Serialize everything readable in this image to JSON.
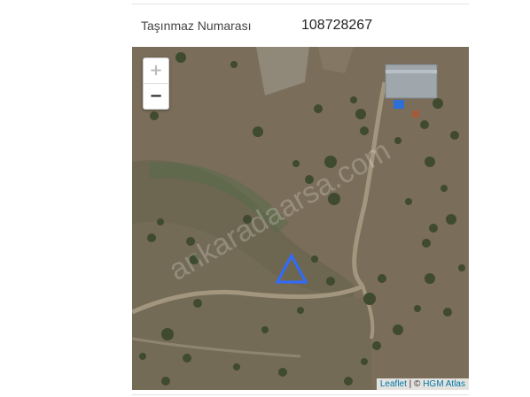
{
  "parcel": {
    "label": "Taşınmaz Numarası",
    "value": "108728267"
  },
  "map": {
    "zoom_in_label": "+",
    "zoom_out_label": "−",
    "watermark": "ankaradaarsa.com",
    "marker_color": "#2f6bff",
    "attribution": {
      "leaflet": "Leaflet",
      "separator": " | © ",
      "provider": "HGM Atlas"
    }
  }
}
